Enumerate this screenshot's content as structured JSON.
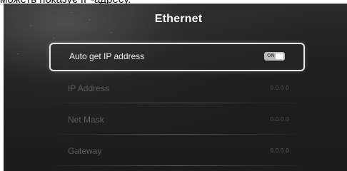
{
  "caption": "можеть показує IP-адресу.",
  "screen": {
    "title": "Ethernet",
    "auto_ip": {
      "label": "Auto get IP address",
      "toggle_label": "ON",
      "toggle_state": "on"
    },
    "rows": [
      {
        "label": "IP Address",
        "value": "0.0.0.0"
      },
      {
        "label": "Net Mask",
        "value": "0.0.0.0"
      },
      {
        "label": "Gateway",
        "value": "0.0.0.0"
      }
    ]
  },
  "colors": {
    "background": "#1c1c1c",
    "title": "#ffffff",
    "selected_border": "#e8e8e8",
    "dim_text": "#5c5c5c",
    "toggle_bg": "#bdbdbd"
  },
  "icons": {
    "toggle": "toggle-switch-icon"
  }
}
